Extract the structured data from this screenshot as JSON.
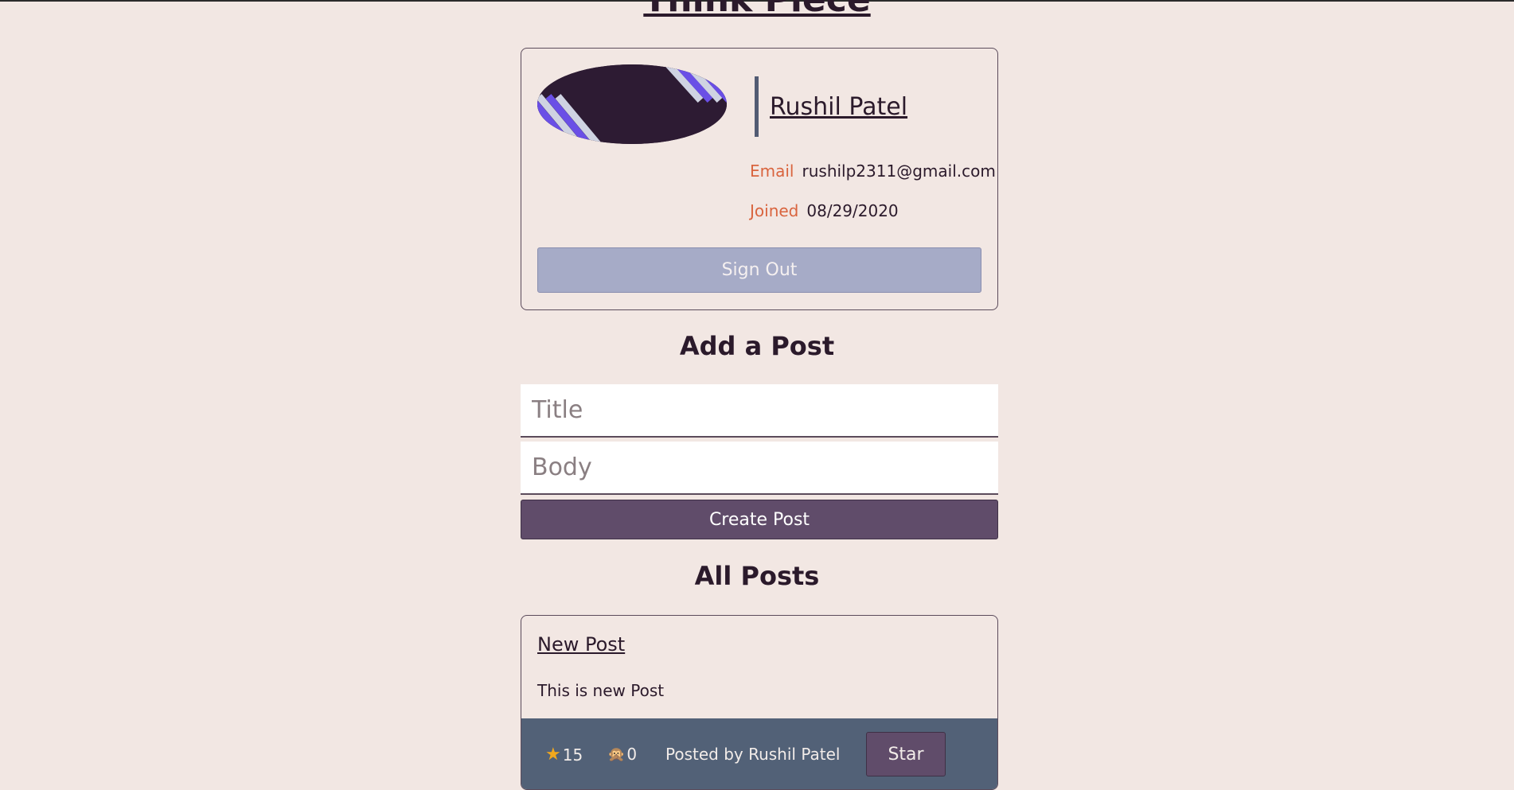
{
  "page": {
    "title": "Think Piece"
  },
  "profile": {
    "name": "Rushil Patel",
    "email_label": "Email",
    "email": "rushilp2311@gmail.com",
    "joined_label": "Joined",
    "joined": "08/29/2020",
    "sign_out_label": "Sign Out"
  },
  "add_post": {
    "heading": "Add a Post",
    "title_placeholder": "Title",
    "body_placeholder": "Body",
    "create_label": "Create Post"
  },
  "all_posts": {
    "heading": "All Posts",
    "posts": [
      {
        "title": "New Post",
        "body": "This is new Post",
        "stars": "15",
        "comments": "0",
        "posted_by": "Posted by Rushil Patel",
        "star_label": "Star"
      }
    ]
  },
  "icons": {
    "stars": "star-icon",
    "comments": "monkey-icon"
  },
  "colors": {
    "background": "#f2e7e3",
    "accent_label": "#d9643e",
    "primary_button": "#604c6a",
    "sign_out_button": "#a6abc7",
    "post_footer": "#526177"
  }
}
